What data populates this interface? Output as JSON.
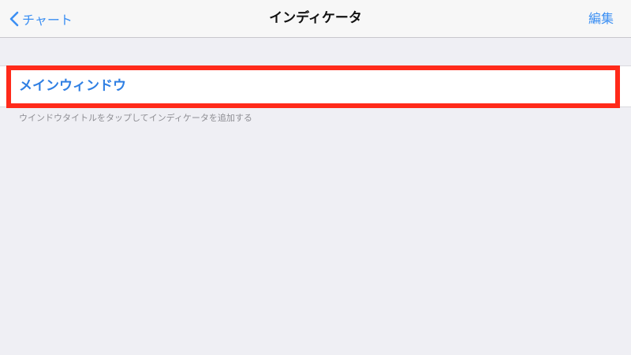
{
  "navbar": {
    "back_label": "チャート",
    "title": "インディケータ",
    "edit_label": "編集"
  },
  "section": {
    "cell_label": "メインウィンドウ",
    "footer": "ウインドウタイトルをタップしてインディケータを追加する"
  },
  "colors": {
    "accent": "#3b8ff3",
    "highlight": "#ff2a1a",
    "background": "#efeff4"
  }
}
